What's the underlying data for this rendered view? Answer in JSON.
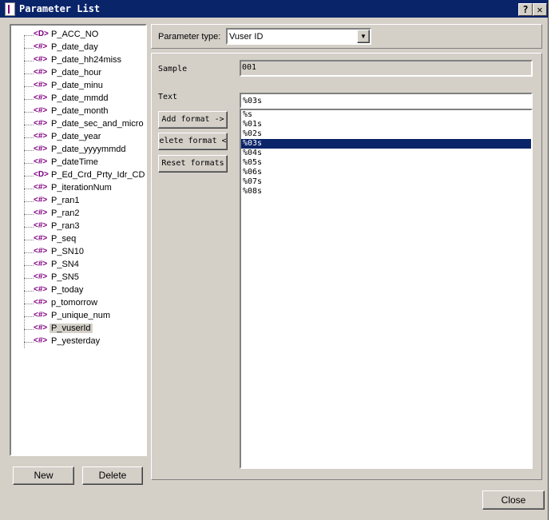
{
  "window": {
    "title": "Parameter List",
    "help": "?",
    "close": "✕"
  },
  "tree": {
    "items": [
      {
        "icon": "<D>",
        "label": "P_ACC_NO"
      },
      {
        "icon": "<#>",
        "label": "P_date_day"
      },
      {
        "icon": "<#>",
        "label": "P_date_hh24miss"
      },
      {
        "icon": "<#>",
        "label": "P_date_hour"
      },
      {
        "icon": "<#>",
        "label": "P_date_minu"
      },
      {
        "icon": "<#>",
        "label": "P_date_mmdd"
      },
      {
        "icon": "<#>",
        "label": "P_date_month"
      },
      {
        "icon": "<#>",
        "label": "P_date_sec_and_micro"
      },
      {
        "icon": "<#>",
        "label": "P_date_year"
      },
      {
        "icon": "<#>",
        "label": "P_date_yyyymmdd"
      },
      {
        "icon": "<#>",
        "label": "P_dateTime"
      },
      {
        "icon": "<D>",
        "label": "P_Ed_Crd_Prty_Idr_CD"
      },
      {
        "icon": "<#>",
        "label": "P_iterationNum"
      },
      {
        "icon": "<#>",
        "label": "P_ran1"
      },
      {
        "icon": "<#>",
        "label": "P_ran2"
      },
      {
        "icon": "<#>",
        "label": "P_ran3"
      },
      {
        "icon": "<#>",
        "label": "P_seq"
      },
      {
        "icon": "<#>",
        "label": "P_SN10"
      },
      {
        "icon": "<#>",
        "label": "P_SN4"
      },
      {
        "icon": "<#>",
        "label": "P_SN5"
      },
      {
        "icon": "<#>",
        "label": "P_today"
      },
      {
        "icon": "<#>",
        "label": "p_tomorrow"
      },
      {
        "icon": "<#>",
        "label": "P_unique_num"
      },
      {
        "icon": "<#>",
        "label": "P_vuserId",
        "selected": true
      },
      {
        "icon": "<#>",
        "label": "P_yesterday"
      }
    ]
  },
  "buttons": {
    "new": "New",
    "delete": "Delete",
    "close": "Close",
    "add_format": "Add format ->",
    "delete_format": "elete format <",
    "reset_formats": "Reset formats"
  },
  "param_type": {
    "label": "Parameter type:",
    "value": "Vuser ID"
  },
  "sample": {
    "label": "Sample",
    "value": "001"
  },
  "text": {
    "label": "Text",
    "value": "%03s"
  },
  "formats": {
    "items": [
      "%s",
      "%01s",
      "%02s",
      "%03s",
      "%04s",
      "%05s",
      "%06s",
      "%07s",
      "%08s"
    ],
    "selected": "%03s"
  }
}
